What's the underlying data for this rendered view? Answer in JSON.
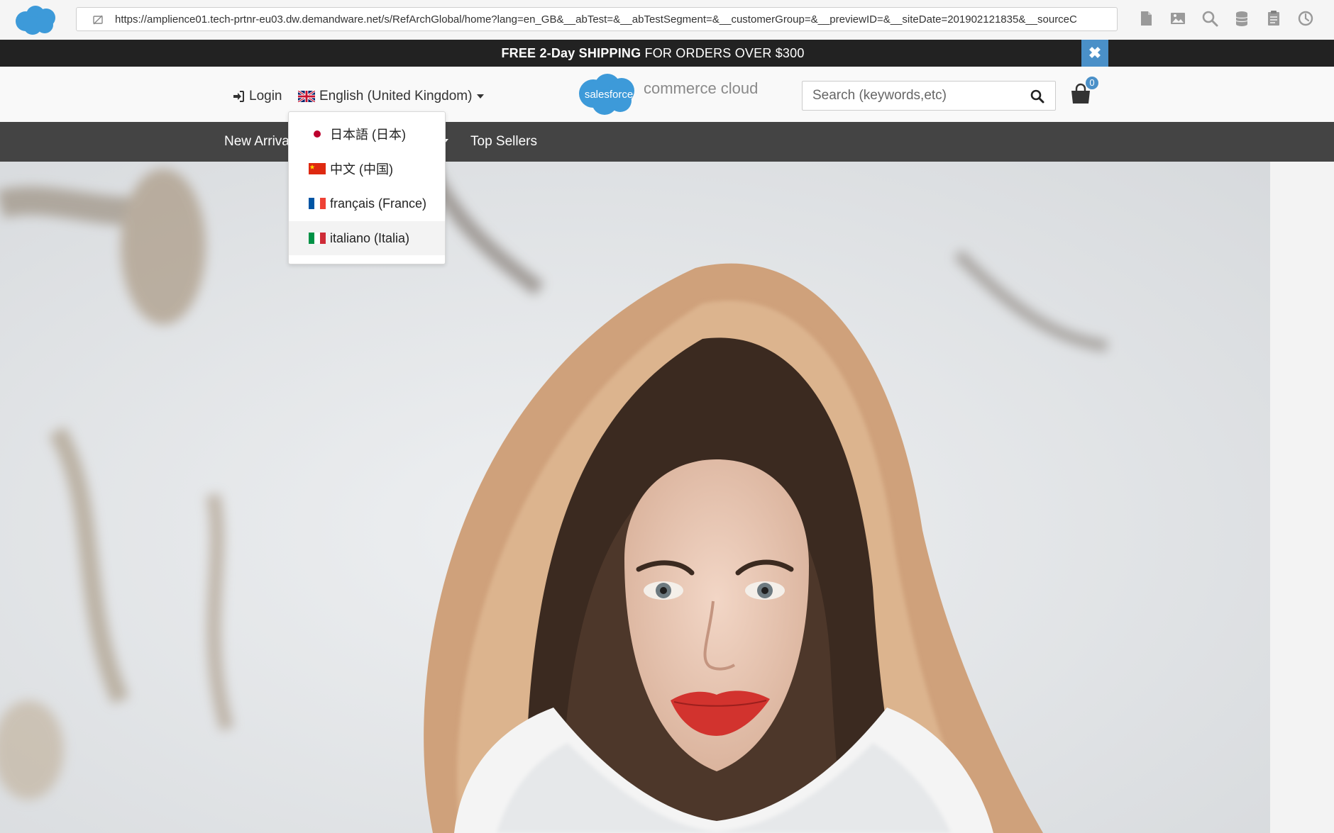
{
  "browser": {
    "url": "https://amplience01.tech-prtnr-eu03.dw.demandware.net/s/RefArchGlobal/home?lang=en_GB&__abTest=&__abTestSegment=&__customerGroup=&__previewID=&__siteDate=201902121835&__sourceC",
    "toolbar_icons": [
      "page-icon",
      "image-icon",
      "search-icon",
      "database-icon",
      "clipboard-icon",
      "clock-icon"
    ]
  },
  "promo": {
    "bold": "FREE 2-Day SHIPPING",
    "rest": " FOR ORDERS OVER $300",
    "close_glyph": "✖"
  },
  "header": {
    "login_label": "Login",
    "language_selected": "English (United Kingdom)",
    "logo_badge": "salesforce",
    "logo_text": "commerce cloud",
    "search_placeholder": "Search (keywords,etc)",
    "cart_count": "0"
  },
  "nav": {
    "items": [
      "New Arrivals",
      "Top Sellers"
    ]
  },
  "language_menu": {
    "items": [
      {
        "label": "日本語 (日本)",
        "flag": "japan"
      },
      {
        "label": "中文 (中国)",
        "flag": "china"
      },
      {
        "label": "français (France)",
        "flag": "france"
      },
      {
        "label": "italiano (Italia)",
        "flag": "italy"
      }
    ],
    "hovered_index": 3
  },
  "colors": {
    "promo_bg": "#222222",
    "accent": "#4a90c8",
    "nav_bg": "#444444"
  }
}
